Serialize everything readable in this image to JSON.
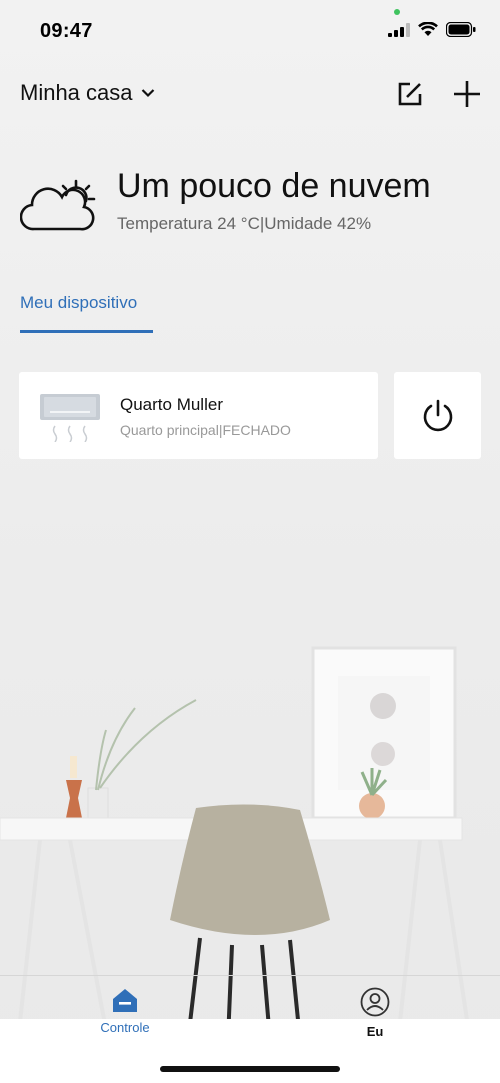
{
  "status_bar": {
    "time": "09:47"
  },
  "header": {
    "home_name": "Minha casa"
  },
  "weather": {
    "title": "Um pouco de nuvem",
    "details": "Temperatura 24 °C|Umidade 42%",
    "icon": "partly-cloudy-icon"
  },
  "tabs": {
    "active_label": "Meu dispositivo"
  },
  "device": {
    "name": "Quarto Muller",
    "status": "Quarto principal|FECHADO",
    "icon": "air-conditioner-icon"
  },
  "bottom_nav": {
    "items": [
      {
        "label": "Controle",
        "icon": "home-icon",
        "active": true
      },
      {
        "label": "Eu",
        "icon": "user-icon",
        "active": false
      }
    ]
  },
  "colors": {
    "accent": "#2f6fb8",
    "card": "#ffffff",
    "background": "#efefef"
  }
}
